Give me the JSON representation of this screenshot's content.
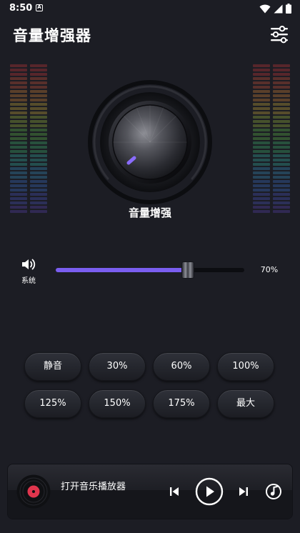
{
  "status_bar": {
    "time": "8:50",
    "notification_letter": "A"
  },
  "header": {
    "title": "音量增强器",
    "settings_icon": "sliders-icon"
  },
  "knob": {
    "label": "音量增强",
    "icon": "volume-knob"
  },
  "volume": {
    "icon": "speaker-icon",
    "label": "系统",
    "value_text": "70%",
    "level": 0.7
  },
  "presets": [
    {
      "label": "静音"
    },
    {
      "label": "30%"
    },
    {
      "label": "60%"
    },
    {
      "label": "100%"
    },
    {
      "label": "125%"
    },
    {
      "label": "150%"
    },
    {
      "label": "175%"
    },
    {
      "label": "最大"
    }
  ],
  "player": {
    "label": "打开音乐播放器",
    "disc_icon": "vinyl-disc-icon",
    "prev_icon": "skip-previous-icon",
    "play_icon": "play-icon",
    "next_icon": "skip-next-icon",
    "music_icon": "music-note-icon"
  },
  "colors": {
    "background": "#1c1d24",
    "accent": "#7a5ef0",
    "vinyl_label": "#e0354d"
  }
}
